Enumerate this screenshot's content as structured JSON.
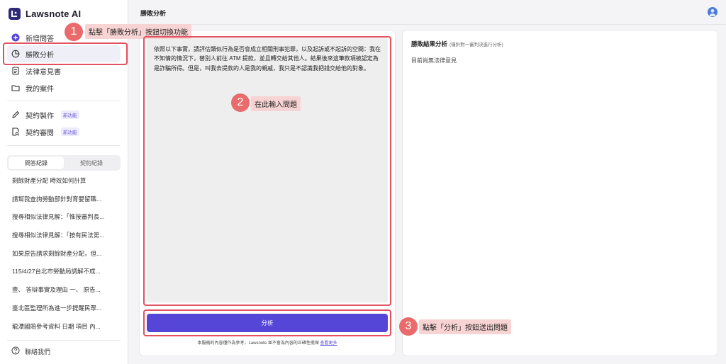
{
  "app": {
    "name": "Lawsnote AI"
  },
  "sidebar": {
    "nav": [
      {
        "label": "新增問答",
        "icon": "plus-circle-icon"
      },
      {
        "label": "勝敗分析",
        "icon": "pie-chart-icon"
      },
      {
        "label": "法律意見書",
        "icon": "document-icon"
      },
      {
        "label": "我的案件",
        "icon": "folder-icon"
      }
    ],
    "tools": [
      {
        "label": "契約製作",
        "badge": "新功能",
        "icon": "pen-icon"
      },
      {
        "label": "契約審閱",
        "badge": "新功能",
        "icon": "doc-search-icon"
      }
    ],
    "history_tabs": [
      "問答紀錄",
      "契約紀錄"
    ],
    "history": [
      "剩餘財產分配 時效如何計算",
      "請幫我查詢勞動部針對育嬰留職...",
      "搜尋相似法律見解：「惟按審判長...",
      "搜尋相似法律見解：「按有民法第...",
      "如果原告請求剩餘財產分配，但...",
      "115/4/27台北市勞動局調解不成...",
      "壹、 答辯事實及理由 一、 原告...",
      "臺北區監理所為進一步提醒民眾...",
      "龍潭國賠參考資料 日期 項目 內..."
    ],
    "contact": "聯絡我們"
  },
  "header": {
    "title": "勝敗分析"
  },
  "main": {
    "question": "依照以下事實，請評估類似行為是否會成立相關刑事犯罪，以及起訴或不起訴的空間：我在不知情的情況下，替別人前往 ATM 提款，並且轉交給其他人。結果後來這筆款項被認定為是詐騙所得。但是，叫我去提款的人是我的親戚，我只是不認識我把錢交給他的對象。",
    "analyze_button": "分析",
    "disclaimer": "本服務的內容僅作為參考，Lawsnote 並不會為內容的正確性擔保",
    "disclaimer_link": "查看更多"
  },
  "result": {
    "title": "勝敗結果分析",
    "subtitle": "(僅針對一審判決進行分析)",
    "empty": "目前尚無法律意見"
  },
  "annotations": [
    {
      "number": "1",
      "text": "點擊「勝敗分析」按鈕切換功能"
    },
    {
      "number": "2",
      "text": "在此輸入問題"
    },
    {
      "number": "3",
      "text": "點擊「分析」按鈕送出問題"
    }
  ],
  "colors": {
    "accent": "#5546d8",
    "annotation": "#e2515f",
    "callout_bg": "#f8d3d3"
  }
}
